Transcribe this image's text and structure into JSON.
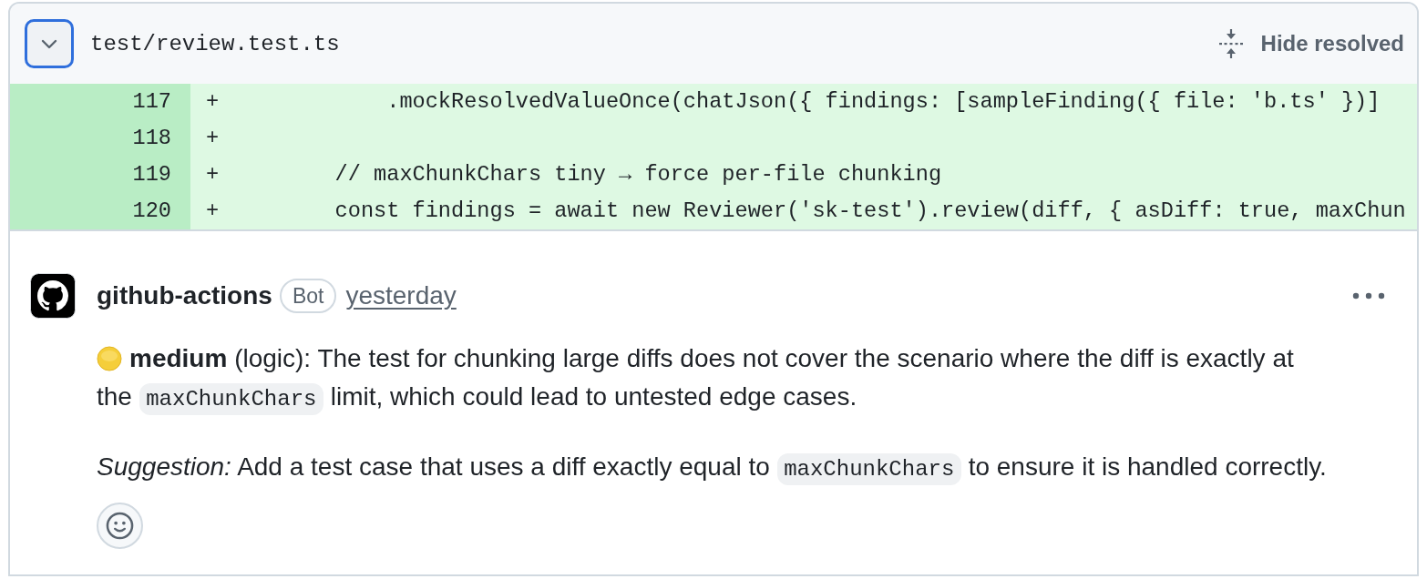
{
  "file_header": {
    "expanded": true,
    "toggle_focused": true,
    "path": "test/review.test.ts",
    "hide_resolved": "Hide resolved"
  },
  "diff_lines": [
    {
      "kind": "addition",
      "line_number": "117",
      "marker": "+",
      "code": "            .mockResolvedValueOnce(chatJson({ findings: [sampleFinding({ file: 'b.ts' })]"
    },
    {
      "kind": "addition",
      "line_number": "118",
      "marker": "+"
    },
    {
      "kind": "addition",
      "line_number": "119",
      "marker": "+",
      "code": "        // maxChunkChars tiny → force per-file chunking"
    },
    {
      "kind": "addition",
      "line_number": "120",
      "marker": "+",
      "code": "        const findings = await new Reviewer('sk-test').review(diff, { asDiff: true, maxChun"
    }
  ],
  "comment": {
    "author": "github-actions",
    "badge": "Bot",
    "time": "yesterday",
    "paragraphs": [
      [
        {
          "kind": "dot"
        },
        {
          "kind": "text",
          "text": "**medium** (logic): The test for chunking large diffs does not cover the scenario where the diff is exactly at the "
        },
        {
          "kind": "code",
          "text": "maxChunkChars"
        },
        {
          "kind": "text",
          "text": " limit, which could lead to untested edge cases."
        }
      ],
      [
        {
          "kind": "text",
          "text": "*Suggestion:* Add a test case that uses a diff exactly equal to "
        },
        {
          "kind": "code",
          "text": "maxChunkChars"
        },
        {
          "kind": "text",
          "text": " to ensure it is handled correctly."
        }
      ]
    ]
  }
}
